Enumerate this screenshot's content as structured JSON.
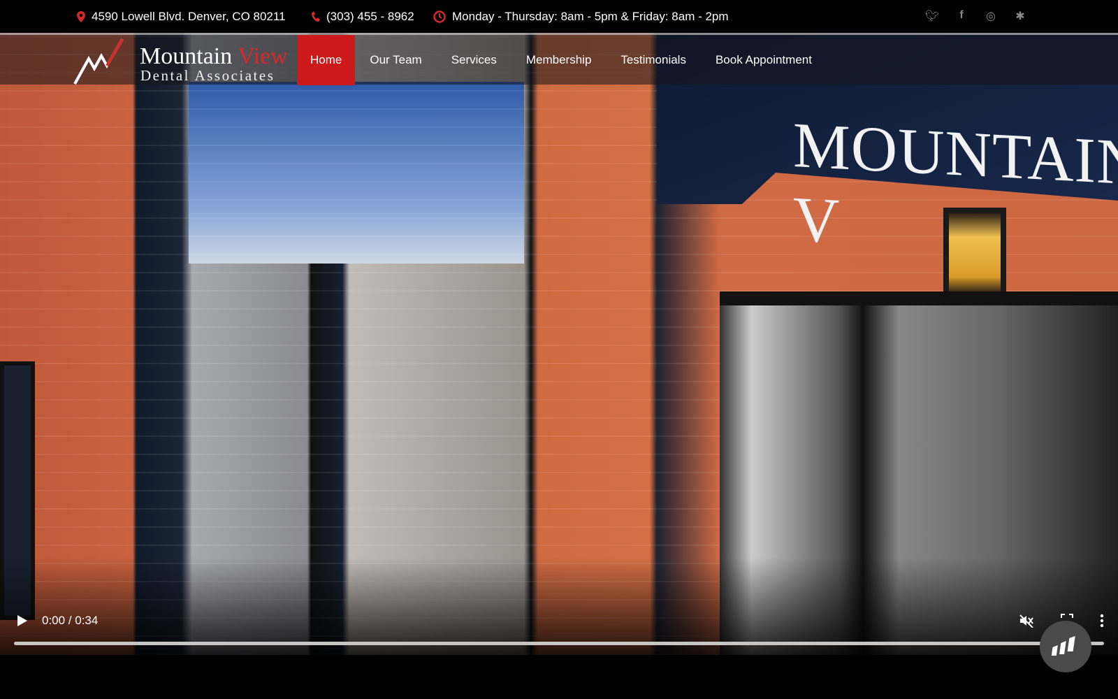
{
  "topbar": {
    "address": "4590 Lowell Blvd. Denver, CO 80211",
    "phone": "(303) 455 - 8962",
    "hours": "Monday - Thursday: 8am - 5pm & Friday: 8am - 2pm",
    "social": [
      "twitter-icon",
      "facebook-icon",
      "instagram-icon",
      "yelp-icon"
    ],
    "accent": "#d42a2a"
  },
  "logo": {
    "line1a": "Mountain ",
    "line1b": "View",
    "line2": "Dental Associates"
  },
  "nav": {
    "items": [
      {
        "label": "Home",
        "active": true
      },
      {
        "label": "Our Team"
      },
      {
        "label": "Services"
      },
      {
        "label": "Membership"
      },
      {
        "label": "Testimonials"
      },
      {
        "label": "Book Appointment"
      }
    ],
    "active_color": "#cc1a1a"
  },
  "video": {
    "sign_text": "MOUNTAIN V",
    "time": "0:00 / 0:34",
    "progress": 0,
    "muted": true
  }
}
